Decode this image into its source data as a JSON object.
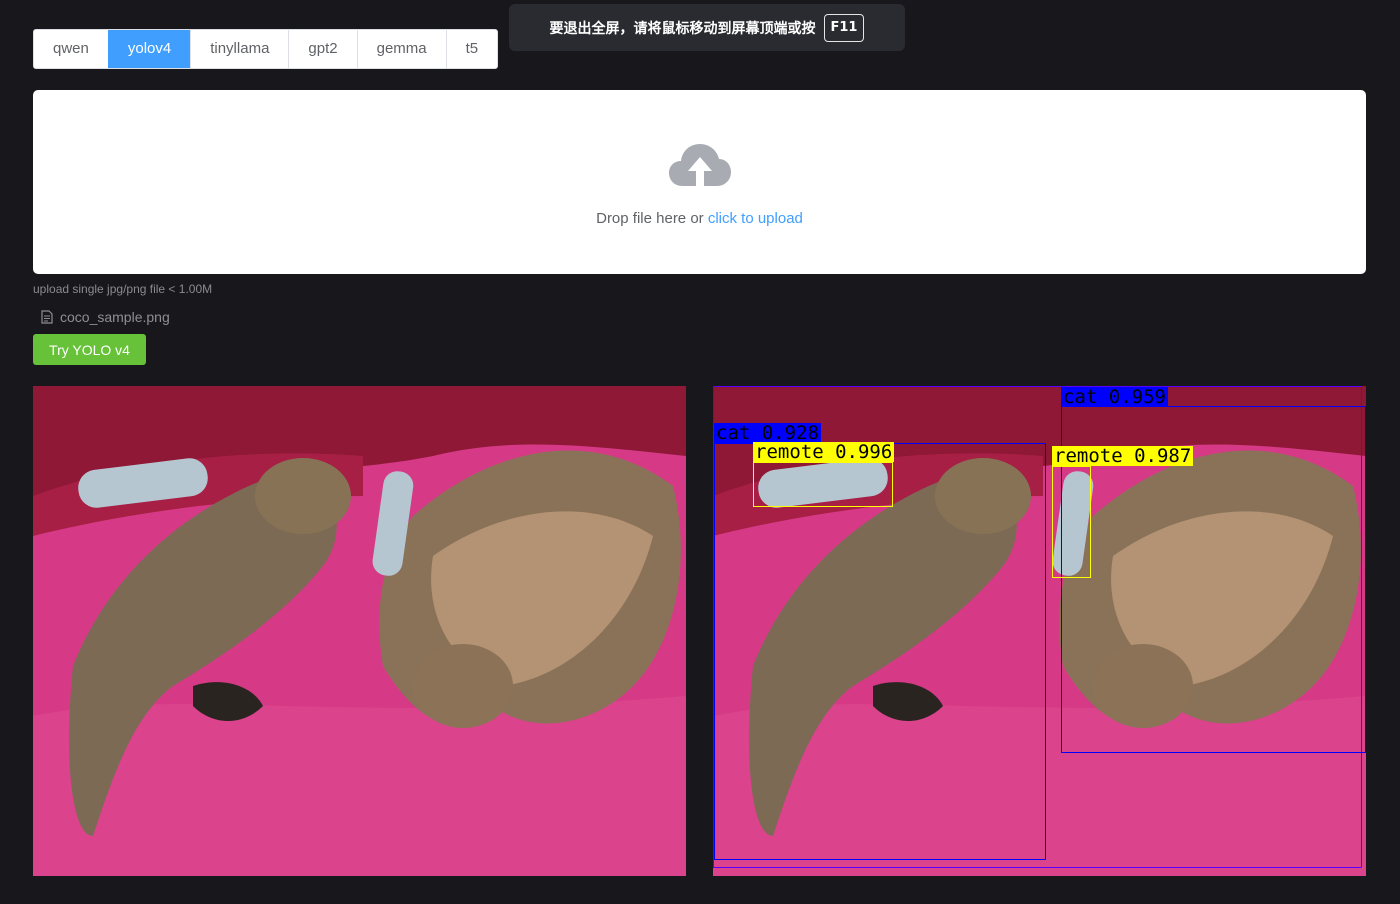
{
  "tabs": [
    {
      "label": "qwen",
      "active": false
    },
    {
      "label": "yolov4",
      "active": true
    },
    {
      "label": "tinyllama",
      "active": false
    },
    {
      "label": "gpt2",
      "active": false
    },
    {
      "label": "gemma",
      "active": false
    },
    {
      "label": "t5",
      "active": false
    }
  ],
  "toast": {
    "message": "要退出全屏，请将鼠标移动到屏幕顶端或按",
    "key": "F11"
  },
  "upload": {
    "icon": "cloud-upload-icon",
    "drop_text": "Drop file here or ",
    "click_text": "click to upload",
    "tip": "upload single jpg/png file < 1.00M"
  },
  "file": {
    "icon": "document-icon",
    "name": "coco_sample.png"
  },
  "action_button": "Try YOLO v4",
  "detections": [
    {
      "label": "cat 0.928",
      "color": "#0000ff",
      "text_color": "#000000"
    },
    {
      "label": "remote 0.996",
      "color": "#ffff00",
      "text_color": "#000000"
    },
    {
      "label": "cat 0.959",
      "color": "#0000ff",
      "text_color": "#000000"
    },
    {
      "label": "remote 0.987",
      "color": "#ffff00",
      "text_color": "#000000"
    }
  ],
  "colors": {
    "background": "#18181c",
    "primary": "#409eff",
    "success": "#67c23a",
    "blanket": "#d63a86"
  }
}
